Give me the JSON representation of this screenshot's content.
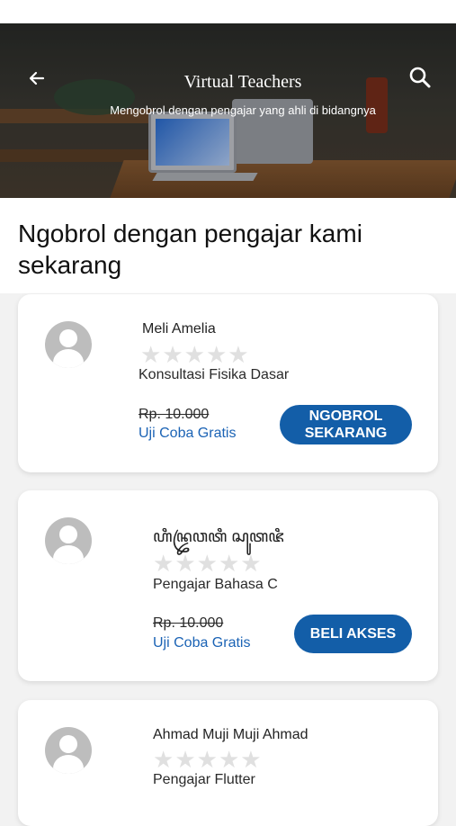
{
  "header": {
    "title": "Virtual Teachers",
    "subtitle": "Mengobrol dengan pengajar yang ahli di bidangnya",
    "back_icon": "arrow-back-icon",
    "search_icon": "search-icon"
  },
  "section": {
    "heading": "Ngobrol dengan pengajar kami sekarang"
  },
  "teachers": [
    {
      "name": "Meli Amelia",
      "subject": "Konsultasi Fisika Dasar",
      "price": "Rp. 10.000",
      "trial": "Uji Coba Gratis",
      "button": "NGOBROL\nSEKARANG",
      "rating": 0
    },
    {
      "name": "ꦲꦶꦤ꧀ꦢꦿꦮꦠꦶ ꦱꦸꦠꦗꦶ",
      "subject": "Pengajar Bahasa C",
      "price": "Rp. 10.000",
      "trial": "Uji Coba Gratis",
      "button": "BELI AKSES",
      "rating": 0
    },
    {
      "name": "Ahmad Muji Muji Ahmad",
      "subject": "Pengajar Flutter",
      "rating": 0
    }
  ],
  "colors": {
    "accent": "#135ea8",
    "link": "#1b63b5",
    "star_empty": "#e0e0e0"
  }
}
